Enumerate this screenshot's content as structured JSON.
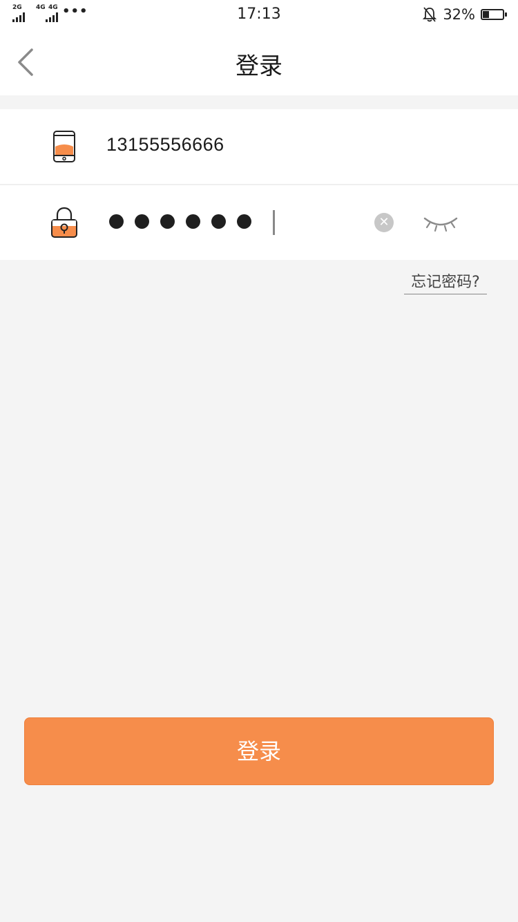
{
  "status_bar": {
    "network_1": "2G",
    "network_2": "4G",
    "network_3": "4G",
    "more": "•••",
    "time": "17:13",
    "battery_percent": "32%",
    "icons": [
      "signal-icon",
      "bell-off-icon",
      "battery-icon"
    ]
  },
  "nav": {
    "title": "登录",
    "back_icon": "chevron-left-icon"
  },
  "form": {
    "phone": {
      "value": "13155556666",
      "icon": "phone-icon"
    },
    "password": {
      "masked_length": 6,
      "icon": "lock-icon",
      "clear_icon": "clear-icon",
      "visibility_icon": "eye-closed-icon"
    }
  },
  "forgot_password": "忘记密码?",
  "login_button": "登录",
  "colors": {
    "accent": "#f68d4b",
    "background": "#f4f4f4",
    "surface": "#ffffff",
    "text": "#1a1a1a"
  }
}
